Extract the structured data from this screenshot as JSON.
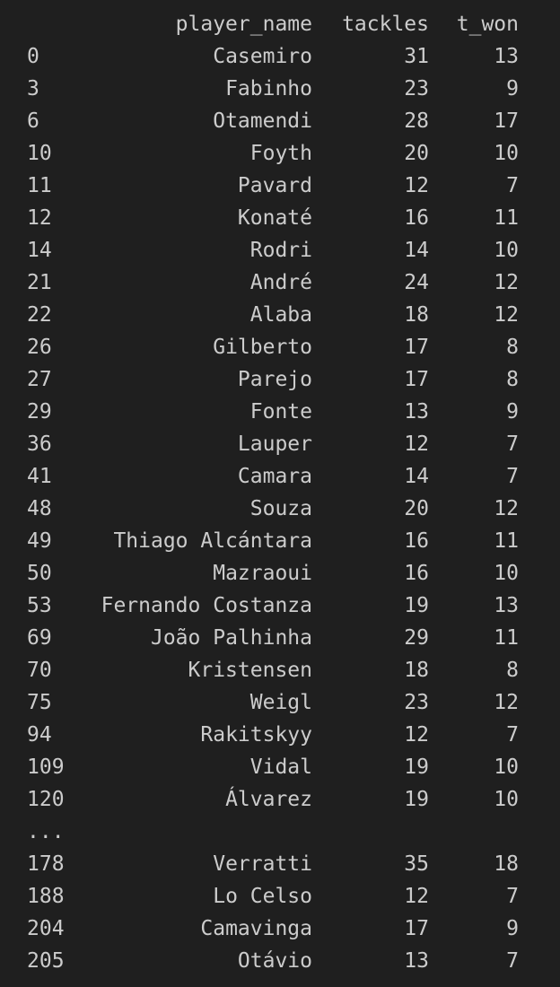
{
  "table": {
    "headers": {
      "index": "",
      "player_name": "player_name",
      "tackles": "tackles",
      "t_won": "t_won"
    },
    "rows_top": [
      {
        "index": "0",
        "player_name": "Casemiro",
        "tackles": "31",
        "t_won": "13"
      },
      {
        "index": "3",
        "player_name": "Fabinho",
        "tackles": "23",
        "t_won": "9"
      },
      {
        "index": "6",
        "player_name": "Otamendi",
        "tackles": "28",
        "t_won": "17"
      },
      {
        "index": "10",
        "player_name": "Foyth",
        "tackles": "20",
        "t_won": "10"
      },
      {
        "index": "11",
        "player_name": "Pavard",
        "tackles": "12",
        "t_won": "7"
      },
      {
        "index": "12",
        "player_name": "Konaté",
        "tackles": "16",
        "t_won": "11"
      },
      {
        "index": "14",
        "player_name": "Rodri",
        "tackles": "14",
        "t_won": "10"
      },
      {
        "index": "21",
        "player_name": "André",
        "tackles": "24",
        "t_won": "12"
      },
      {
        "index": "22",
        "player_name": "Alaba",
        "tackles": "18",
        "t_won": "12"
      },
      {
        "index": "26",
        "player_name": "Gilberto",
        "tackles": "17",
        "t_won": "8"
      },
      {
        "index": "27",
        "player_name": "Parejo",
        "tackles": "17",
        "t_won": "8"
      },
      {
        "index": "29",
        "player_name": "Fonte",
        "tackles": "13",
        "t_won": "9"
      },
      {
        "index": "36",
        "player_name": "Lauper",
        "tackles": "12",
        "t_won": "7"
      },
      {
        "index": "41",
        "player_name": "Camara",
        "tackles": "14",
        "t_won": "7"
      },
      {
        "index": "48",
        "player_name": "Souza",
        "tackles": "20",
        "t_won": "12"
      },
      {
        "index": "49",
        "player_name": "Thiago Alcántara",
        "tackles": "16",
        "t_won": "11"
      },
      {
        "index": "50",
        "player_name": "Mazraoui",
        "tackles": "16",
        "t_won": "10"
      },
      {
        "index": "53",
        "player_name": "Fernando Costanza",
        "tackles": "19",
        "t_won": "13"
      },
      {
        "index": "69",
        "player_name": "João Palhinha",
        "tackles": "29",
        "t_won": "11"
      },
      {
        "index": "70",
        "player_name": "Kristensen",
        "tackles": "18",
        "t_won": "8"
      },
      {
        "index": "75",
        "player_name": "Weigl",
        "tackles": "23",
        "t_won": "12"
      },
      {
        "index": "94",
        "player_name": "Rakitskyy",
        "tackles": "12",
        "t_won": "7"
      },
      {
        "index": "109",
        "player_name": "Vidal",
        "tackles": "19",
        "t_won": "10"
      },
      {
        "index": "120",
        "player_name": "Álvarez",
        "tackles": "19",
        "t_won": "10"
      }
    ],
    "ellipsis": "...",
    "rows_bottom": [
      {
        "index": "178",
        "player_name": "Verratti",
        "tackles": "35",
        "t_won": "18"
      },
      {
        "index": "188",
        "player_name": "Lo Celso",
        "tackles": "12",
        "t_won": "7"
      },
      {
        "index": "204",
        "player_name": "Camavinga",
        "tackles": "17",
        "t_won": "9"
      },
      {
        "index": "205",
        "player_name": "Otávio",
        "tackles": "13",
        "t_won": "7"
      }
    ]
  }
}
